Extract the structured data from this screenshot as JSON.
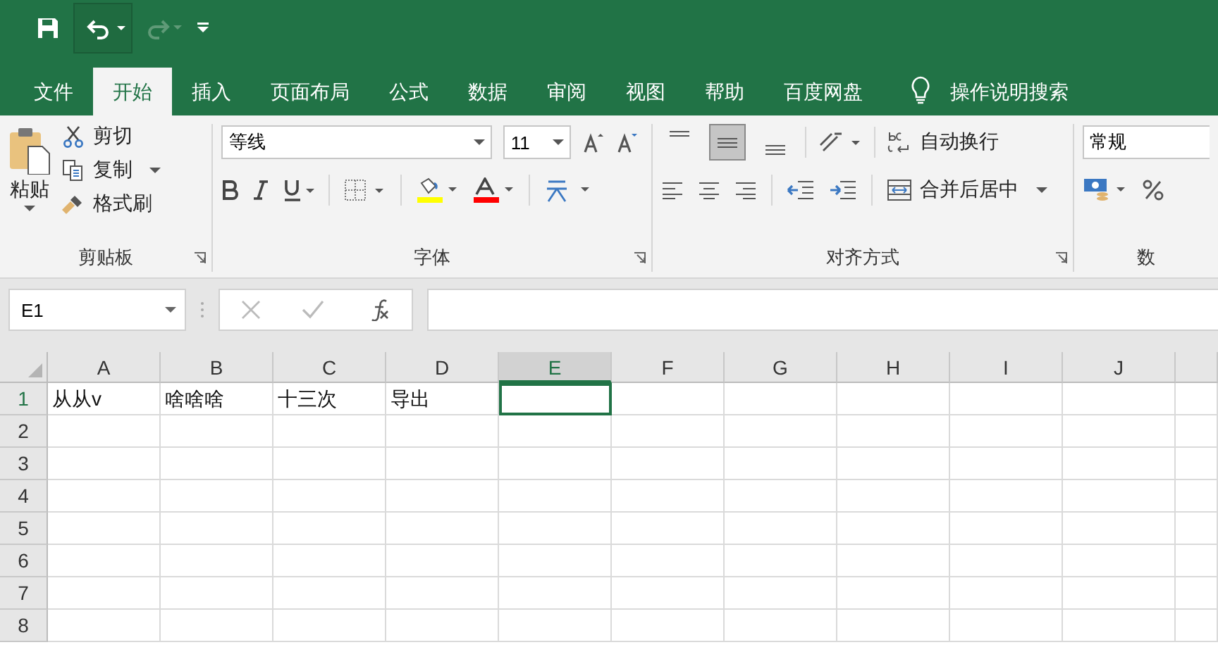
{
  "tabs": [
    {
      "label": "文件",
      "selected": false
    },
    {
      "label": "开始",
      "selected": true
    },
    {
      "label": "插入",
      "selected": false
    },
    {
      "label": "页面布局",
      "selected": false
    },
    {
      "label": "公式",
      "selected": false
    },
    {
      "label": "数据",
      "selected": false
    },
    {
      "label": "审阅",
      "selected": false
    },
    {
      "label": "视图",
      "selected": false
    },
    {
      "label": "帮助",
      "selected": false
    },
    {
      "label": "百度网盘",
      "selected": false
    }
  ],
  "tell_me": "操作说明搜索",
  "clipboard": {
    "paste": "粘贴",
    "cut": "剪切",
    "copy": "复制",
    "format_painter": "格式刷",
    "label": "剪贴板"
  },
  "font": {
    "font_name": "等线",
    "font_size": "11",
    "label": "字体"
  },
  "alignment": {
    "vertical": [
      {
        "selected": false
      },
      {
        "selected": true
      },
      {
        "selected": false
      }
    ],
    "wrap_text": "自动换行",
    "merge": "合并后居中",
    "label": "对齐方式"
  },
  "number": {
    "format": "常规",
    "label": "数"
  },
  "name_box": "E1",
  "columns": [
    {
      "label": "A",
      "selected": false
    },
    {
      "label": "B",
      "selected": false
    },
    {
      "label": "C",
      "selected": false
    },
    {
      "label": "D",
      "selected": false
    },
    {
      "label": "E",
      "selected": true
    },
    {
      "label": "F",
      "selected": false
    },
    {
      "label": "G",
      "selected": false
    },
    {
      "label": "H",
      "selected": false
    },
    {
      "label": "I",
      "selected": false
    },
    {
      "label": "J",
      "selected": false
    }
  ],
  "rows": [
    {
      "label": "1",
      "cells": [
        {
          "value": "从从v",
          "selected": false
        },
        {
          "value": "啥啥啥",
          "selected": false
        },
        {
          "value": "十三次",
          "selected": false
        },
        {
          "value": "导出",
          "selected": false
        },
        {
          "selected": true
        }
      ]
    },
    {
      "label": "2"
    },
    {
      "label": "3"
    },
    {
      "label": "4"
    },
    {
      "label": "5"
    },
    {
      "label": "6"
    },
    {
      "label": "7"
    },
    {
      "label": "8"
    }
  ]
}
